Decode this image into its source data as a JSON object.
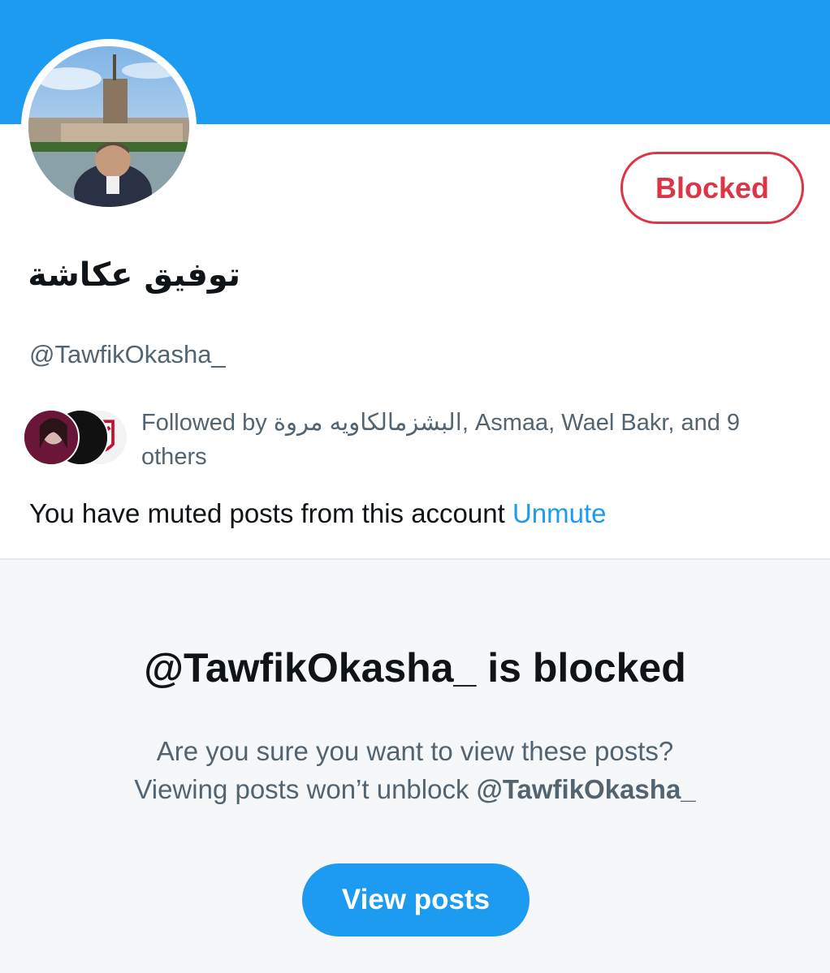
{
  "colors": {
    "banner": "#1d9bf0",
    "accent": "#1d9bf0",
    "blocked_red": "#dc3545",
    "secondary_text": "#536471",
    "panel_bg": "#f6f7f8"
  },
  "profile": {
    "display_name": "توفيق عكاشة",
    "handle": "@TawfikOkasha_",
    "avatar_icon": "profile-photo",
    "blocked_button_label": "Blocked"
  },
  "followers_you_know": {
    "prefix": "Followed by ",
    "names_arabic": "البشزمالكاويه مروة",
    "rest": ", Asmaa, Wael Bakr, and 9 others"
  },
  "mute_notice": {
    "text": "You have muted posts from this account ",
    "action_label": "Unmute"
  },
  "blocked_panel": {
    "title": "@TawfikOkasha_ is blocked",
    "line1": "Are you sure you want to view these posts?",
    "line2_prefix": "Viewing posts won’t unblock ",
    "line2_handle": "@TawfikOkasha_",
    "button_label": "View posts"
  }
}
